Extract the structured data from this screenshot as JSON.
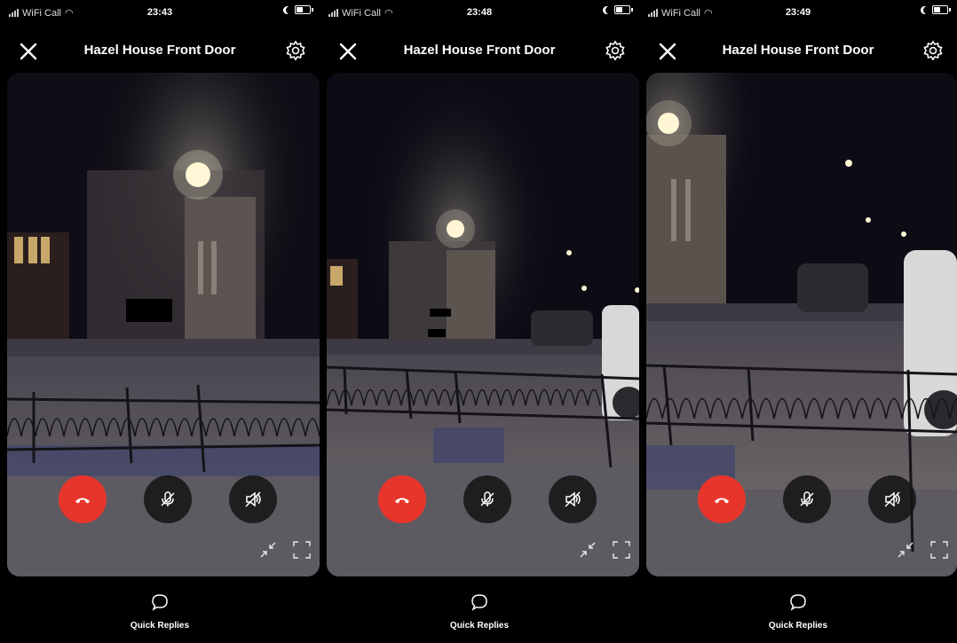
{
  "colors": {
    "end_call": "#e8352c",
    "control_dark": "#141414",
    "night_sky": "#0d0b14",
    "lamp": "#fff7d6"
  },
  "icons": {
    "close": "close-icon",
    "settings": "gear-icon",
    "end_call": "phone-hangup-icon",
    "mute_mic": "microphone-muted-icon",
    "mute_speaker": "speaker-muted-icon",
    "minimize": "minimize-arrows-icon",
    "fullscreen": "fullscreen-icon",
    "quick_replies": "speech-bubble-icon"
  },
  "panels": [
    {
      "status": {
        "carrier": "WiFi Call",
        "time": "23:43"
      },
      "header": {
        "title": "Hazel House Front Door"
      },
      "quick_replies": {
        "label": "Quick Replies"
      }
    },
    {
      "status": {
        "carrier": "WiFi Call",
        "time": "23:48"
      },
      "header": {
        "title": "Hazel House Front Door"
      },
      "quick_replies": {
        "label": "Quick Replies"
      }
    },
    {
      "status": {
        "carrier": "WiFi Call",
        "time": "23:49"
      },
      "header": {
        "title": "Hazel House Front Door"
      },
      "quick_replies": {
        "label": "Quick Replies"
      }
    }
  ]
}
